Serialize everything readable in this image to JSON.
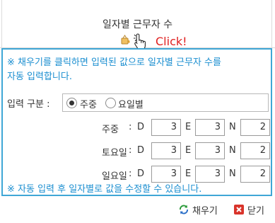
{
  "header": {
    "title": "일자별 근무자 수",
    "click_label": "Click!"
  },
  "notice": {
    "line1": "※ 채우기를 클릭하면 입력된 값으로 일자별 근무자 수를",
    "line2": "자동 입력합니다.",
    "line3": "※ 자동 입력 후 일자별로 값을 수정할 수 있습니다."
  },
  "input_type": {
    "label": "입력 구분 :",
    "options": [
      {
        "label": "주중",
        "selected": true
      },
      {
        "label": "요일별",
        "selected": false
      }
    ]
  },
  "rows": [
    {
      "label": "주중",
      "colon": ":",
      "D": "3",
      "E": "3",
      "N": "2"
    },
    {
      "label": "토요일",
      "colon": ":",
      "D": "3",
      "E": "3",
      "N": "2"
    },
    {
      "label": "일요일",
      "colon": ":",
      "D": "3",
      "E": "3",
      "N": "2"
    }
  ],
  "shift_letters": {
    "D": "D",
    "E": "E",
    "N": "N"
  },
  "footer": {
    "fill_button": "채우기",
    "close_button": "닫기"
  },
  "colors": {
    "accent": "#3fa7d6",
    "notice_text": "#1a8ed0",
    "click_text": "#e02020"
  },
  "icons": {
    "fill": "refresh-arrows-icon",
    "close": "close-x-icon",
    "cursor": "hand-pointer-icon",
    "header_fill": "fill-icon"
  }
}
